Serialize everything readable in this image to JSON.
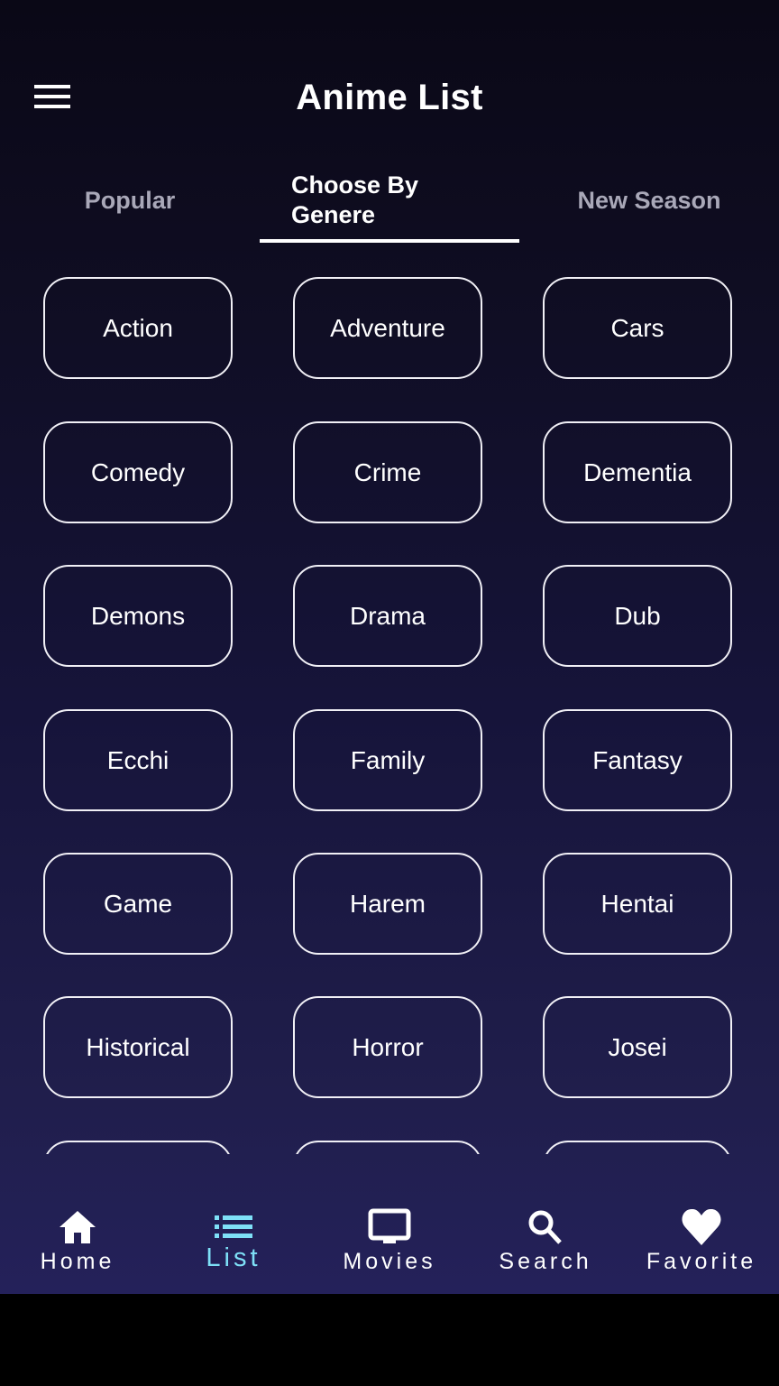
{
  "app": {
    "title": "Anime List",
    "menu_icon": "hamburger-menu-icon"
  },
  "tabs": [
    {
      "label": "Popular",
      "active": false
    },
    {
      "label": "Choose By Genere",
      "line1": "Choose By",
      "line2": "Genere",
      "active": true
    },
    {
      "label": "New Season",
      "active": false
    }
  ],
  "genres": [
    "Action",
    "Adventure",
    "Cars",
    "Comedy",
    "Crime",
    "Dementia",
    "Demons",
    "Drama",
    "Dub",
    "Ecchi",
    "Family",
    "Fantasy",
    "Game",
    "Harem",
    "Hentai",
    "Historical",
    "Horror",
    "Josei",
    "",
    "",
    ""
  ],
  "bottom_nav": [
    {
      "label": "Home",
      "icon": "home-icon",
      "active": false
    },
    {
      "label": "List",
      "icon": "list-icon",
      "active": true
    },
    {
      "label": "Movies",
      "icon": "tv-icon",
      "active": false
    },
    {
      "label": "Search",
      "icon": "search-icon",
      "active": false
    },
    {
      "label": "Favorite",
      "icon": "heart-icon",
      "active": false
    }
  ],
  "colors": {
    "accent": "#7ee0f7",
    "text": "#ffffff",
    "inactive_tab": "#a9a8b8",
    "background_top": "#0a0816",
    "background_bottom": "#24215a"
  }
}
